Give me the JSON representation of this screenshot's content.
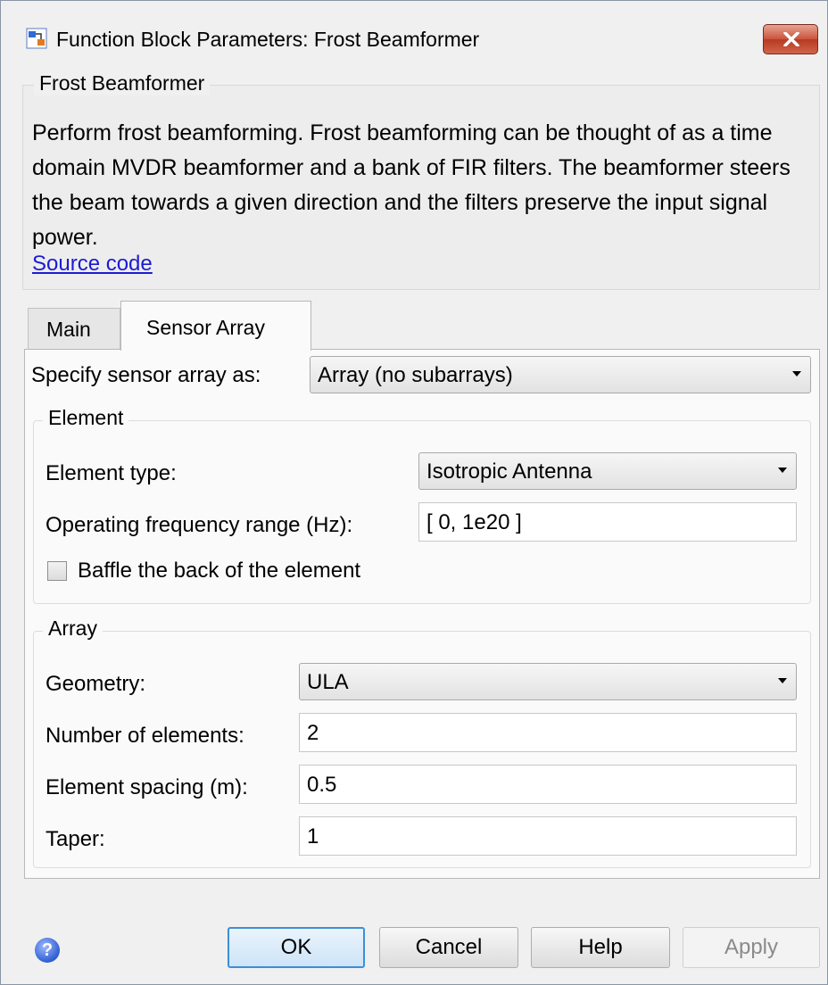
{
  "window": {
    "title": "Function Block Parameters: Frost Beamformer",
    "close_icon": "close-icon",
    "app_icon": "simulink-block-icon"
  },
  "description": {
    "group_title": "Frost Beamformer",
    "text": "Perform frost beamforming. Frost beamforming can be thought of as a time domain MVDR beamformer and a bank of FIR filters. The beamformer steers the beam towards a given direction and the filters preserve the input signal power.",
    "link": "Source code"
  },
  "tabs": [
    {
      "label": "Main",
      "active": false
    },
    {
      "label": "Sensor Array",
      "active": true
    }
  ],
  "sensor_array": {
    "specify_label": "Specify sensor array as:",
    "specify_value": "Array (no subarrays)"
  },
  "element": {
    "group_title": "Element",
    "type_label": "Element type:",
    "type_value": "Isotropic Antenna",
    "freq_label": "Operating frequency range (Hz):",
    "freq_value": "[ 0, 1e20 ]",
    "baffle_label": "Baffle the back of the element",
    "baffle_checked": false
  },
  "array": {
    "group_title": "Array",
    "geometry_label": "Geometry:",
    "geometry_value": "ULA",
    "num_elements_label": "Number of elements:",
    "num_elements_value": "2",
    "spacing_label": "Element spacing (m):",
    "spacing_value": "0.5",
    "taper_label": "Taper:",
    "taper_value": "1"
  },
  "buttons": {
    "ok": "OK",
    "cancel": "Cancel",
    "help": "Help",
    "apply": "Apply",
    "help_icon": "question-mark-icon"
  },
  "colors": {
    "link": "#1b1bd3",
    "close_button": "#c9533d",
    "ok_border": "#3c8fd8"
  }
}
